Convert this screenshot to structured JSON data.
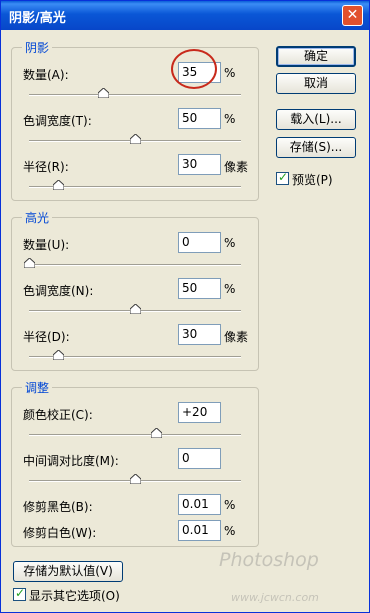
{
  "dialog": {
    "title": "阴影/高光",
    "close_glyph": "✕"
  },
  "shadows": {
    "legend": "阴影",
    "amount": {
      "label": "数量(A):",
      "value": "35",
      "unit": "%",
      "slider_fraction": 0.35
    },
    "tonal_width": {
      "label": "色调宽度(T):",
      "value": "50",
      "unit": "%",
      "slider_fraction": 0.5
    },
    "radius": {
      "label": "半径(R):",
      "value": "30",
      "unit": "像素",
      "slider_fraction": 0.14
    }
  },
  "highlights": {
    "legend": "高光",
    "amount": {
      "label": "数量(U):",
      "value": "0",
      "unit": "%",
      "slider_fraction": 0.0
    },
    "tonal_width": {
      "label": "色调宽度(N):",
      "value": "50",
      "unit": "%",
      "slider_fraction": 0.5
    },
    "radius": {
      "label": "半径(D):",
      "value": "30",
      "unit": "像素",
      "slider_fraction": 0.14
    }
  },
  "adjustments": {
    "legend": "调整",
    "color_correction": {
      "label": "颜色校正(C):",
      "value": "+20",
      "slider_fraction": 0.6
    },
    "midtone_contrast": {
      "label": "中间调对比度(M):",
      "value": "0",
      "slider_fraction": 0.5
    },
    "black_clip": {
      "label": "修剪黑色(B):",
      "value": "0.01",
      "unit": "%"
    },
    "white_clip": {
      "label": "修剪白色(W):",
      "value": "0.01",
      "unit": "%"
    }
  },
  "buttons": {
    "ok": "确定",
    "cancel": "取消",
    "load": "载入(L)...",
    "save": "存储(S)...",
    "save_default": "存储为默认值(V)"
  },
  "checkboxes": {
    "preview": {
      "label": "预览(P)",
      "checked": true
    },
    "show_more": {
      "label": "显示其它选项(O)",
      "checked": true
    }
  },
  "watermark": {
    "brand": "Photoshop",
    "url": "www.jcwcn.com"
  },
  "colors": {
    "titlebar": "#0a57d6",
    "legend_text": "#0046d5",
    "annotation_circle": "#c82a1c"
  }
}
